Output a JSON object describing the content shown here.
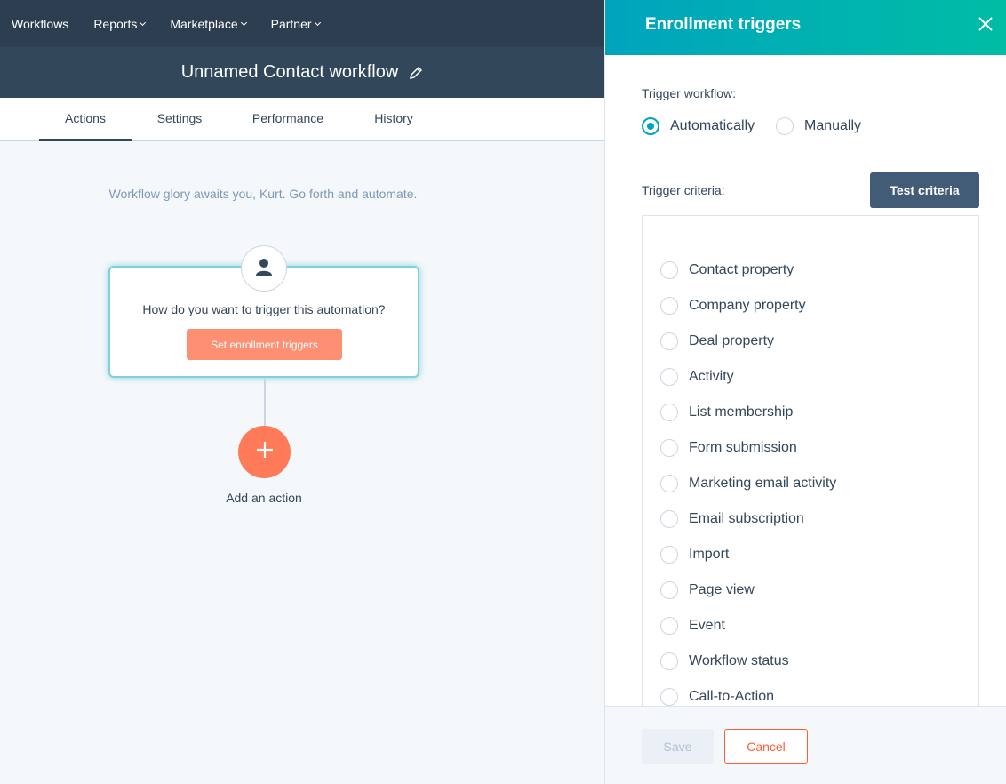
{
  "nav": {
    "items": [
      {
        "label": "Workflows",
        "dropdown": false
      },
      {
        "label": "Reports",
        "dropdown": true
      },
      {
        "label": "Marketplace",
        "dropdown": true
      },
      {
        "label": "Partner",
        "dropdown": true
      }
    ]
  },
  "workflow": {
    "title": "Unnamed Contact workflow"
  },
  "tabs": [
    {
      "label": "Actions",
      "active": true
    },
    {
      "label": "Settings",
      "active": false
    },
    {
      "label": "Performance",
      "active": false
    },
    {
      "label": "History",
      "active": false
    }
  ],
  "canvas": {
    "tagline": "Workflow glory awaits you, Kurt. Go forth and automate.",
    "trigger_question": "How do you want to trigger this automation?",
    "set_triggers_label": "Set enrollment triggers",
    "add_action_label": "Add an action"
  },
  "panel": {
    "title": "Enrollment triggers",
    "trigger_workflow_label": "Trigger workflow:",
    "trigger_options": [
      {
        "label": "Automatically",
        "selected": true
      },
      {
        "label": "Manually",
        "selected": false
      }
    ],
    "trigger_criteria_label": "Trigger criteria:",
    "test_criteria_label": "Test criteria",
    "criteria": [
      "Contact property",
      "Company property",
      "Deal property",
      "Activity",
      "List membership",
      "Form submission",
      "Marketing email activity",
      "Email subscription",
      "Import",
      "Page view",
      "Event",
      "Workflow status",
      "Call-to-Action"
    ],
    "save_label": "Save",
    "cancel_label": "Cancel"
  },
  "colors": {
    "nav_bg": "#2d3e50",
    "accent_teal": "#00a4bd",
    "accent_orange": "#ff7a59",
    "text_dark": "#33475b"
  }
}
